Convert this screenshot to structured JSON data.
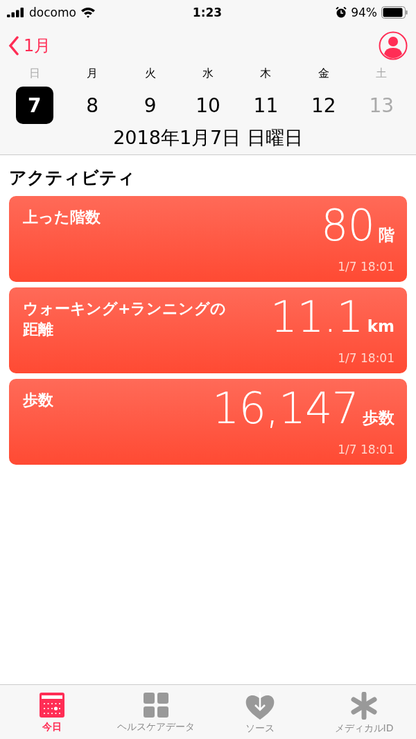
{
  "status_bar": {
    "carrier": "docomo",
    "time": "1:23",
    "battery": "94%"
  },
  "nav": {
    "back_label": "1月"
  },
  "week": [
    {
      "weekday": "日",
      "date": "7",
      "weekend": true,
      "selected": true
    },
    {
      "weekday": "月",
      "date": "8",
      "weekend": false,
      "selected": false
    },
    {
      "weekday": "火",
      "date": "9",
      "weekend": false,
      "selected": false
    },
    {
      "weekday": "水",
      "date": "10",
      "weekend": false,
      "selected": false
    },
    {
      "weekday": "木",
      "date": "11",
      "weekend": false,
      "selected": false
    },
    {
      "weekday": "金",
      "date": "12",
      "weekend": false,
      "selected": false
    },
    {
      "weekday": "土",
      "date": "13",
      "weekend": true,
      "selected": false
    }
  ],
  "date_title": "2018年1月7日 日曜日",
  "section_title": "アクティビティ",
  "cards": [
    {
      "title": "上った階数",
      "value": "80",
      "unit": "階",
      "time": "1/7 18:01"
    },
    {
      "title": "ウォーキング+ランニングの距離",
      "value": "11.1",
      "unit": "km",
      "time": "1/7 18:01"
    },
    {
      "title": "歩数",
      "value": "16,147",
      "unit": "歩数",
      "time": "1/7 18:01"
    }
  ],
  "tabs": [
    {
      "label": "今日",
      "kind": "calendar",
      "selected": true
    },
    {
      "label": "ヘルスケアデータ",
      "kind": "grid",
      "selected": false
    },
    {
      "label": "ソース",
      "kind": "heart",
      "selected": false
    },
    {
      "label": "メディカルID",
      "kind": "asterisk",
      "selected": false
    }
  ]
}
